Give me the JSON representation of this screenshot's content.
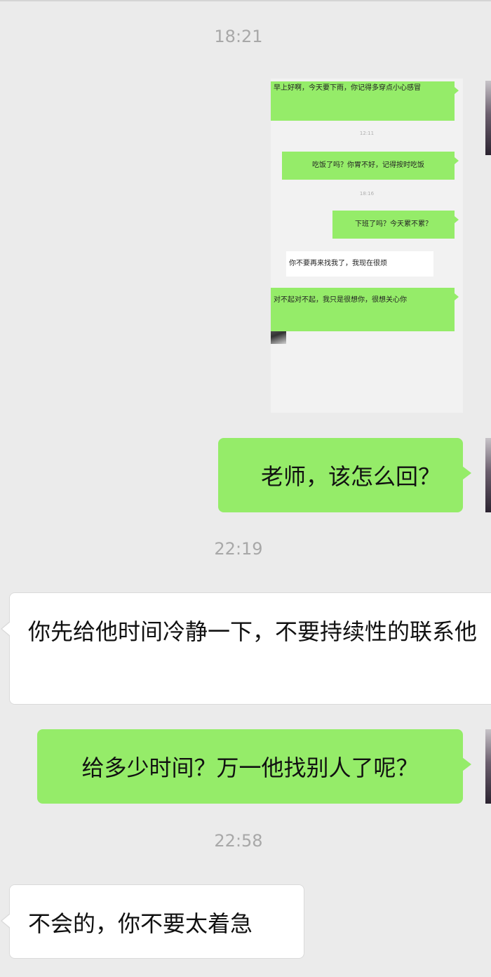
{
  "timestamps": [
    "18:21",
    "22:19",
    "22:58"
  ],
  "screenshot": {
    "messages": [
      {
        "text": "早上好啊，今天要下雨，你记得多穿点小心感冒"
      },
      {
        "text": "吃饭了吗？你胃不好，记得按时吃饭"
      },
      {
        "text": "下班了吗？今天累不累？"
      },
      {
        "text": "你不要再来找我了，我现在很烦"
      },
      {
        "text": "对不起对不起，我只是很想你，很想关心你"
      }
    ],
    "mini_timestamps": [
      "12:11",
      "18:16"
    ]
  },
  "messages": [
    {
      "text": "老师，该怎么回？"
    },
    {
      "text": "你先给他时间冷静一下，不要持续性的联系他"
    },
    {
      "text": "给多少时间？万一他找别人了呢？"
    },
    {
      "text": "不会的，你不要太着急"
    }
  ]
}
